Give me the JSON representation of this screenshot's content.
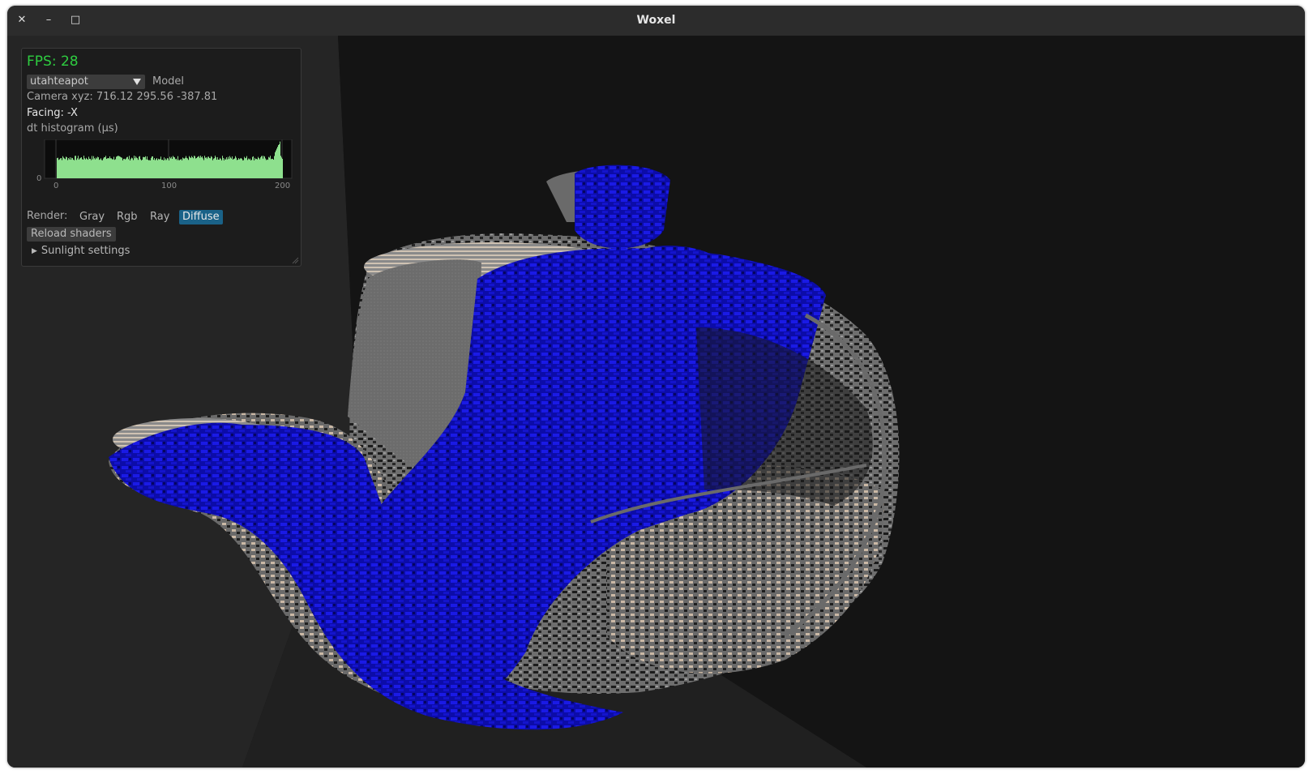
{
  "window": {
    "title": "Woxel",
    "close_glyph": "✕",
    "minimize_glyph": "–",
    "maximize_glyph": "□"
  },
  "panel": {
    "fps_text": "FPS: 28",
    "model": {
      "selected": "utahteapot",
      "label": "Model"
    },
    "camera_text": "Camera xyz: 716.12 295.56 -387.81",
    "facing_text": "Facing: -X",
    "histogram": {
      "label": "dt histogram (µs)",
      "y_tick": "0",
      "x_ticks": [
        "0",
        "100",
        "200"
      ],
      "bar_color": "#8ee08e"
    },
    "render": {
      "label": "Render:",
      "options": [
        "Gray",
        "Rgb",
        "Ray",
        "Diffuse"
      ],
      "selected": "Diffuse"
    },
    "reload_label": "Reload shaders",
    "sunlight_label": "Sunlight settings"
  },
  "colors": {
    "fps": "#2ecc40",
    "voxel_blue": "#1010d8",
    "voxel_gray": "#7a7a7a",
    "voxel_beige": "#cbb9a6",
    "selected_option_bg": "#1a6288"
  }
}
